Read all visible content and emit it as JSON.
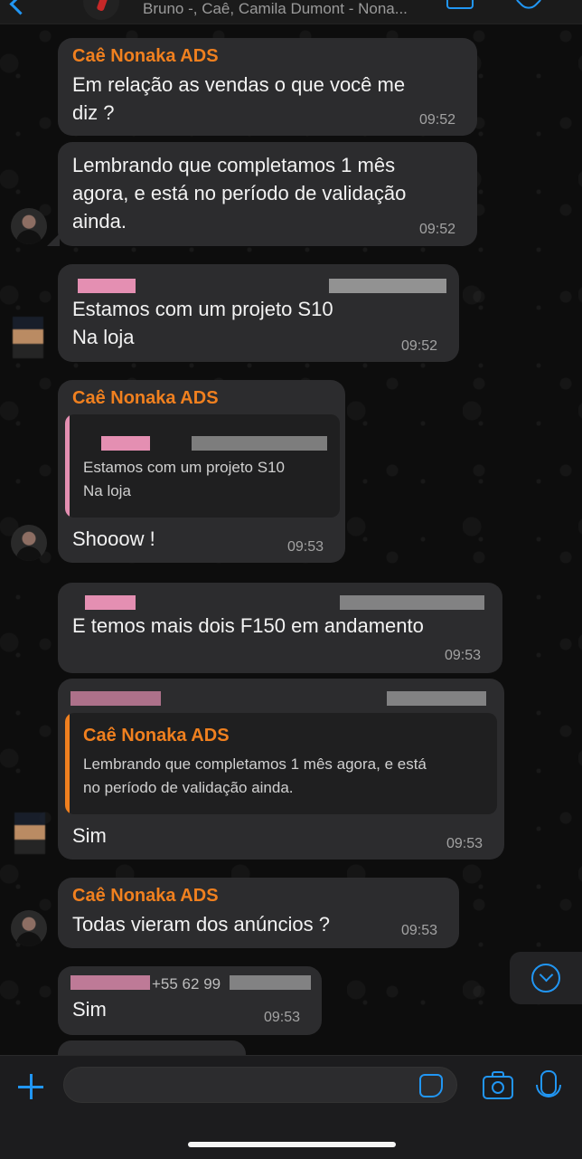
{
  "header": {
    "title": "Bruno -, Caê, Camila Dumont - Nona..."
  },
  "colors": {
    "accent": "#2196f3",
    "sender": "#f0801f",
    "bubble": "#2c2c2e",
    "background": "#0d0d0d"
  },
  "messages": [
    {
      "sender": "Caê Nonaka ADS",
      "lines": [
        "Em relação as vendas o que você me",
        "diz ?"
      ],
      "time": "09:52"
    },
    {
      "lines": [
        "Lembrando que completamos 1 mês",
        "agora, e está no período de validação",
        "ainda."
      ],
      "time": "09:52"
    },
    {
      "lines": [
        "Estamos com um projeto S10",
        "Na loja"
      ],
      "time": "09:52"
    },
    {
      "sender": "Caê Nonaka ADS",
      "quote": {
        "lines": [
          "Estamos com um projeto S10",
          "Na loja"
        ]
      },
      "lines": [
        "Shooow !"
      ],
      "time": "09:53"
    },
    {
      "lines": [
        "E temos mais dois F150 em andamento"
      ],
      "time": "09:53"
    },
    {
      "quote": {
        "sender": "Caê Nonaka ADS",
        "lines": [
          "Lembrando que completamos 1 mês agora, e está",
          "no período de validação ainda."
        ]
      },
      "lines": [
        "Sim"
      ],
      "time": "09:53"
    },
    {
      "sender": "Caê Nonaka ADS",
      "lines": [
        "Todas vieram dos anúncios ?"
      ],
      "time": "09:53"
    },
    {
      "phone_partial": "+55 62 99",
      "lines": [
        "Sim"
      ],
      "time": "09:53"
    }
  ],
  "composer": {
    "placeholder": ""
  },
  "icons": {
    "back": "chevron-left-icon",
    "video": "video-call-icon",
    "call": "phone-icon",
    "attach": "plus-icon",
    "sticker": "sticker-icon",
    "camera": "camera-icon",
    "mic": "microphone-icon",
    "scroll": "chevron-down-icon"
  }
}
